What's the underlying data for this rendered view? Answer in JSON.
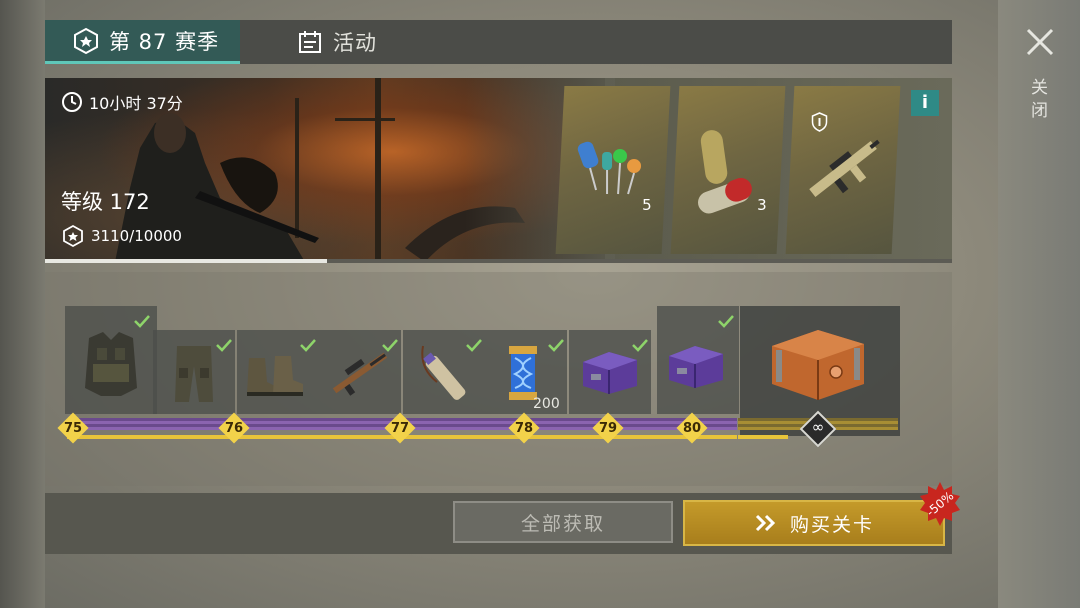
{
  "tabs": [
    {
      "label": "第 87 赛季",
      "icon": "season-badge-icon",
      "active": true
    },
    {
      "label": "活动",
      "icon": "calendar-icon",
      "active": false
    }
  ],
  "close": {
    "label": "关闭",
    "icon": "close-icon"
  },
  "banner": {
    "timer": "10小时 37分",
    "level": "等级 172",
    "xp": "3110/10000",
    "xp_progress": 0.311,
    "info": "i",
    "rewards": [
      {
        "icon": "electronic-components-icon",
        "qty": "5"
      },
      {
        "icon": "capsule-pills-icon",
        "qty": "3"
      },
      {
        "icon": "assault-rifle-icon",
        "qty": ""
      }
    ]
  },
  "track": {
    "levels": [
      {
        "level": "75",
        "items": [
          "tactical-vest-icon"
        ]
      },
      {
        "level": "76",
        "items": [
          "cargo-pants-icon",
          "combat-boots-icon"
        ]
      },
      {
        "level": "77",
        "items": [
          "sniper-rifle-icon",
          "crossbow-quiver-icon"
        ]
      },
      {
        "level": "78",
        "items": [
          "dna-capsule-icon"
        ],
        "count": "200"
      },
      {
        "level": "79",
        "items": [
          "purple-supply-crate-icon"
        ]
      },
      {
        "level": "80",
        "items": [
          "purple-supply-crate-icon"
        ]
      }
    ],
    "final": {
      "symbol": "∞",
      "item": "orange-supply-chest-icon"
    }
  },
  "footer": {
    "claim_all": "全部获取",
    "buy_levels": "购买关卡",
    "discount": "-50%"
  },
  "colors": {
    "accent_teal": "#5fc7b9",
    "gold": "#e8c43a",
    "purple": "#8b64b0",
    "discount_red": "#c8261e"
  }
}
